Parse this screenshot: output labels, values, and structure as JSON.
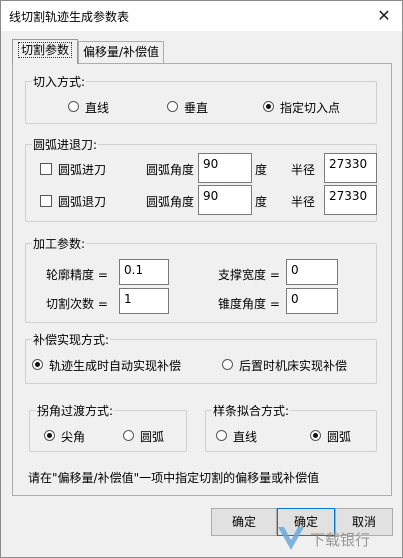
{
  "window": {
    "title": "线切割轨迹生成参数表",
    "close": "✕"
  },
  "tabs": [
    {
      "label": "切割参数",
      "active": true
    },
    {
      "label": "偏移量/补偿值",
      "active": false
    }
  ],
  "entry_mode": {
    "title": "切入方式:",
    "options": [
      "直线",
      "垂直",
      "指定切入点"
    ],
    "selected": "指定切入点"
  },
  "arc_feed": {
    "title": "圆弧进退刀:",
    "rows": [
      {
        "check_label": "圆弧进刀",
        "checked": false,
        "angle_label": "圆弧角度",
        "angle_value": "90",
        "angle_unit": "度",
        "radius_label": "半径",
        "radius_value": "27330"
      },
      {
        "check_label": "圆弧退刀",
        "checked": false,
        "angle_label": "圆弧角度",
        "angle_value": "90",
        "angle_unit": "度",
        "radius_label": "半径",
        "radius_value": "27330"
      }
    ]
  },
  "machining": {
    "title": "加工参数:",
    "contour_precision_label": "轮廓精度 =",
    "contour_precision_value": "0.1",
    "cut_count_label": "切割次数 =",
    "cut_count_value": "1",
    "support_width_label": "支撑宽度 =",
    "support_width_value": "0",
    "taper_angle_label": "锥度角度 =",
    "taper_angle_value": "0"
  },
  "compensation": {
    "title": "补偿实现方式:",
    "options": [
      "轨迹生成时自动实现补偿",
      "后置时机床实现补偿"
    ],
    "selected": "轨迹生成时自动实现补偿"
  },
  "corner": {
    "title": "拐角过渡方式:",
    "options": [
      "尖角",
      "圆弧"
    ],
    "selected": "尖角"
  },
  "spline": {
    "title": "样条拟合方式:",
    "options": [
      "直线",
      "圆弧"
    ],
    "selected": "圆弧"
  },
  "hint": "请在\"偏移量/补偿值\"一项中指定切割的偏移量或补偿值",
  "buttons": {
    "ok": "确定",
    "ok2": "确定",
    "cancel": "取消"
  },
  "watermark": {
    "text": "下载银行"
  }
}
